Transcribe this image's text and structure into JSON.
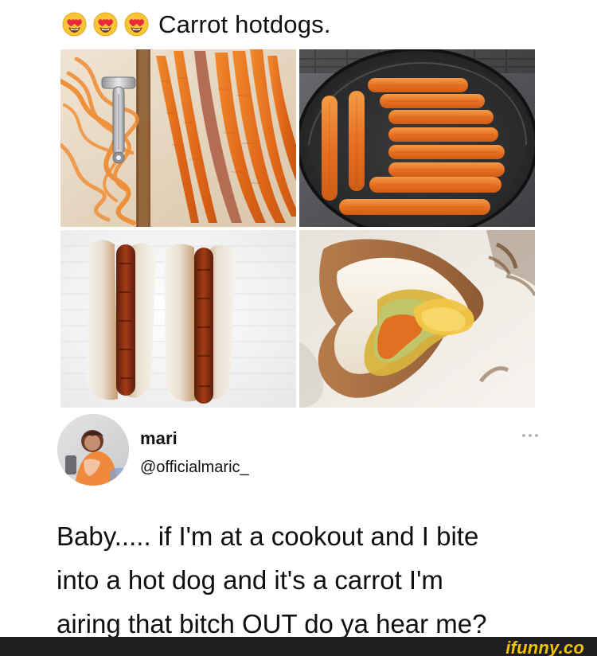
{
  "post": {
    "title": "Carrot hotdogs.",
    "title_emojis": [
      "heart-eyes-emoji",
      "heart-eyes-emoji",
      "heart-eyes-emoji"
    ]
  },
  "photos": [
    {
      "name": "photo-carrots-on-board",
      "icon": "carrot-board-image"
    },
    {
      "name": "photo-carrots-in-pan",
      "icon": "carrot-pan-image"
    },
    {
      "name": "photo-carrot-hotdogs",
      "icon": "carrot-hotdog-image"
    },
    {
      "name": "photo-carrot-hotdog-bitten",
      "icon": "bitten-hotdog-image"
    }
  ],
  "tweet": {
    "display_name": "mari",
    "handle": "@officialmaric_",
    "text": "Baby..... if I'm at a cookout and I bite\ninto a hot dog and it's a carrot I'm\nairing that bitch OUT do ya hear me?",
    "more_icon": "ellipsis-icon"
  },
  "footer": {
    "brand": "ifunny.co"
  },
  "colors": {
    "carrot": "#e56a1c",
    "footer_bg": "#1f1f1f",
    "brand_yellow": "#f2c200"
  }
}
